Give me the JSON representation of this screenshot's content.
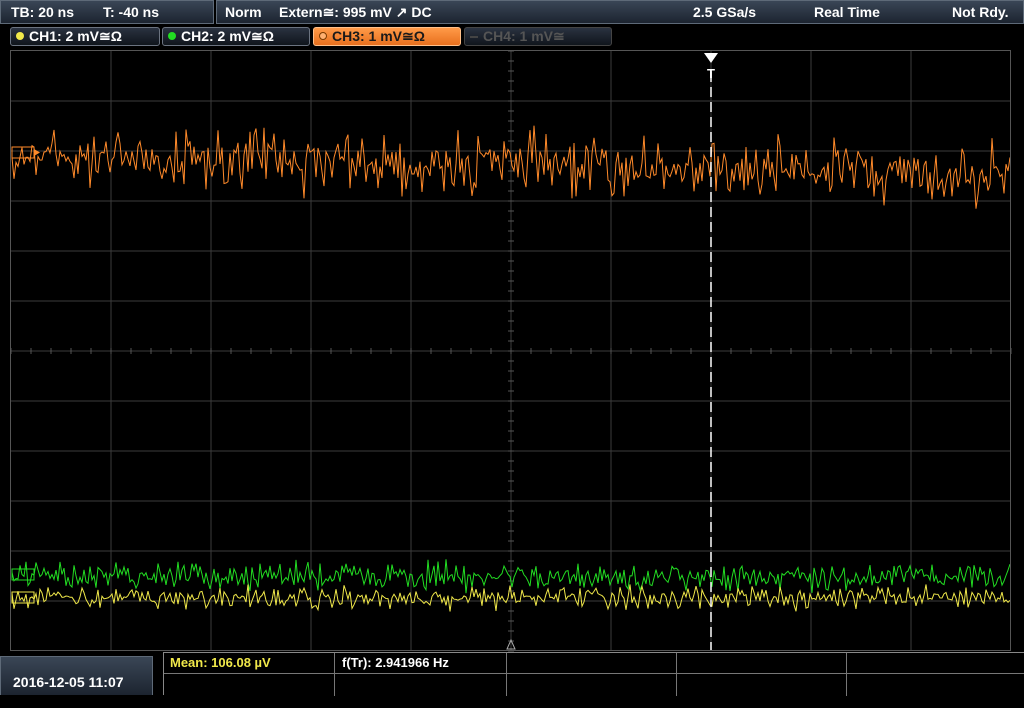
{
  "top": {
    "timebase": "TB: 20 ns",
    "trigger_time": "T: -40 ns",
    "mode": "Norm",
    "trigger_source": "Extern≅: 995 mV ↗ DC",
    "sample_rate": "2.5 GSa/s",
    "acq_mode": "Real Time",
    "status": "Not Rdy."
  },
  "channels": [
    {
      "label": "CH1: 2 mV≅Ω",
      "color": "#f0e84a",
      "state": "on"
    },
    {
      "label": "CH2: 2 mV≅Ω",
      "color": "#22dd22",
      "state": "on"
    },
    {
      "label": "CH3: 1 mV≅Ω",
      "color": "#ff8a2a",
      "state": "selected"
    },
    {
      "label": "CH4: 1 mV≅",
      "color": "#555555",
      "state": "off"
    }
  ],
  "trigger_marker": "T",
  "measurements": {
    "mean": "Mean: 106.08 µV",
    "freq": "f(Tr): 2.941966 Hz"
  },
  "datetime": "2016-12-05 11:07",
  "colors": {
    "grid": "#3c3c3c",
    "ch1": "#f0e84a",
    "ch2": "#22dd22",
    "ch3": "#ff8a2a"
  }
}
